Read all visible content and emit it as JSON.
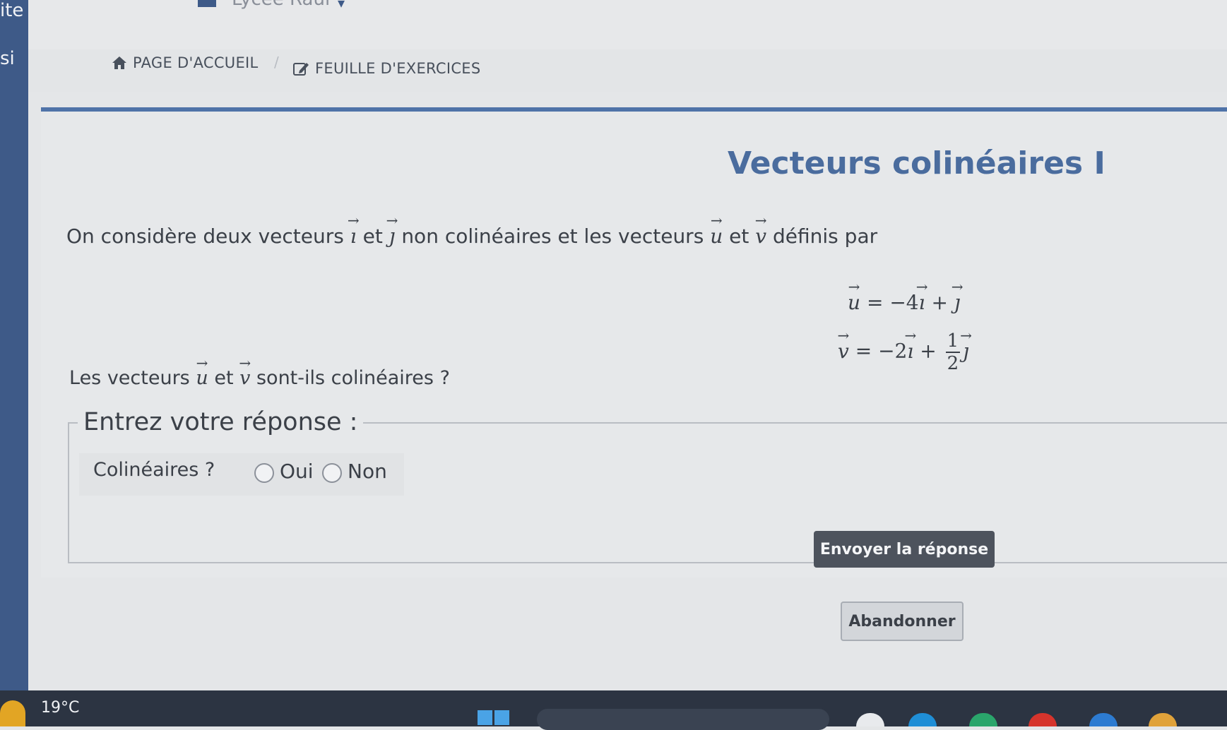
{
  "topbar": {
    "user_name": "Lycée Raul",
    "sidebar_fragments": [
      "ite",
      "si"
    ]
  },
  "breadcrumb": {
    "home_label": "PAGE D'ACCUEIL",
    "separator": "/",
    "exercises_label": "FEUILLE D'EXERCICES"
  },
  "exercise": {
    "title": "Vecteurs colinéaires I",
    "statement": {
      "part1": "On considère deux vecteurs",
      "vec_i": "ı",
      "and1": "et",
      "vec_j": "ȷ",
      "part2": "non colinéaires et les vecteurs",
      "vec_u": "u",
      "and2": "et",
      "vec_v": "v",
      "part3": "définis par"
    },
    "equations": {
      "u_lhs": "u",
      "u_rhs_coef": "= −4",
      "u_rhs_i": "ı",
      "u_rhs_plus": "+",
      "u_rhs_j": "ȷ",
      "v_lhs": "v",
      "v_rhs_coef": "= −2",
      "v_rhs_i": "ı",
      "v_rhs_plus": "+",
      "v_frac_num": "1",
      "v_frac_den": "2",
      "v_rhs_j": "ȷ"
    },
    "question": {
      "part1": "Les vecteurs",
      "vec_u": "u",
      "and": "et",
      "vec_v": "v",
      "part2": "sont-ils colinéaires ?"
    }
  },
  "answer": {
    "legend": "Entrez votre réponse :",
    "field_label": "Colinéaires ?",
    "options": [
      "Oui",
      "Non"
    ],
    "selected": null,
    "submit_label": "Envoyer la réponse",
    "abandon_label": "Abandonner"
  },
  "taskbar": {
    "temperature": "19°C"
  },
  "colors": {
    "sidebar": "#3e5a88",
    "title": "#4a6c9e",
    "card_border": "#4f73a8",
    "submit_button": "#4d535d"
  }
}
